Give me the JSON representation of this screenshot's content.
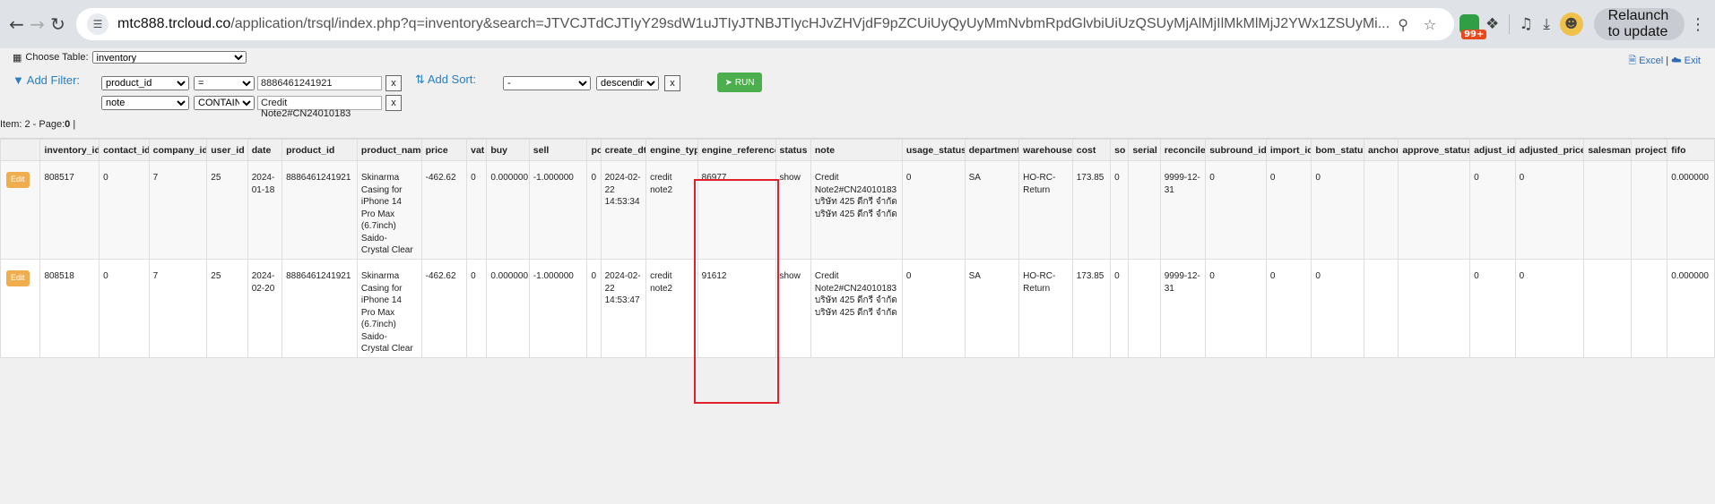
{
  "browser": {
    "url_host": "mtc888.trcloud.co",
    "url_rest": "/application/trsql/index.php?q=inventory&search=JTVCJTdCJTIyY29sdW1uJTIyJTNBJTIycHJvZHVjdF9pZCUiUyQyUyMmNvbmRpdGlvbiUiUzQSUyMjAlMjIlMkMlMjJ2YWx1ZSUyMi...",
    "extension_badge": "99+",
    "relaunch_label": "Relaunch to update"
  },
  "toolbar": {
    "choose_table_label": "Choose Table:",
    "table_value": "inventory",
    "excel_label": "Excel",
    "separator": "|",
    "exit_label": "Exit"
  },
  "filters": {
    "add_filter_label": "Add Filter:",
    "rows": [
      {
        "column": "product_id",
        "operator": "=",
        "value": "8886461241921",
        "remove": "x"
      },
      {
        "column": "note",
        "operator": "CONTAIN",
        "value": "Credit Note2#CN24010183",
        "remove": "x"
      }
    ]
  },
  "sort": {
    "add_sort_label": "Add Sort:",
    "column": "-",
    "direction": "descending",
    "remove": "x"
  },
  "run_label": "RUN",
  "item_info": "Item: 2 - Page:",
  "item_page": "0",
  "item_sep": "|",
  "table": {
    "columns": [
      "",
      "inventory_id",
      "contact_id",
      "company_id",
      "user_id",
      "date",
      "product_id",
      "product_name",
      "price",
      "vat",
      "buy",
      "sell",
      "po",
      "create_dt",
      "engine_type",
      "engine_reference",
      "status",
      "note",
      "usage_status",
      "department",
      "warehouse",
      "cost",
      "so",
      "serial",
      "reconcile",
      "subround_id",
      "import_id",
      "bom_status",
      "anchor",
      "approve_status",
      "adjust_id",
      "adjusted_price",
      "salesman",
      "project",
      "fifo"
    ],
    "edit_label": "Edit",
    "rows": [
      {
        "inventory_id": "808517",
        "contact_id": "0",
        "company_id": "7",
        "user_id": "25",
        "date": "2024-01-18",
        "product_id": "8886461241921",
        "product_name": "Skinarma Casing for iPhone 14 Pro Max (6.7inch) Saido- Crystal Clear",
        "price": "-462.62",
        "vat": "0",
        "buy": "0.000000",
        "sell": "-1.000000",
        "po": "0",
        "create_dt": "2024-02-22 14:53:34",
        "engine_type": "credit note2",
        "engine_reference": "86977",
        "status": "show",
        "note": "Credit Note2#CN24010183 บริษัท 425 ดีกรี จำกัด บริษัท 425 ดีกรี จำกัด",
        "usage_status": "0",
        "department": "SA",
        "warehouse": "HO-RC-Return",
        "cost": "173.85",
        "so": "0",
        "serial": "",
        "reconcile": "9999-12-31",
        "subround_id": "0",
        "import_id": "0",
        "bom_status": "0",
        "anchor": "",
        "approve_status": "",
        "adjust_id": "0",
        "adjusted_price": "0",
        "salesman": "",
        "project": "",
        "fifo": "0.000000"
      },
      {
        "inventory_id": "808518",
        "contact_id": "0",
        "company_id": "7",
        "user_id": "25",
        "date": "2024-02-20",
        "product_id": "8886461241921",
        "product_name": "Skinarma Casing for iPhone 14 Pro Max (6.7inch) Saido- Crystal Clear",
        "price": "-462.62",
        "vat": "0",
        "buy": "0.000000",
        "sell": "-1.000000",
        "po": "0",
        "create_dt": "2024-02-22 14:53:47",
        "engine_type": "credit note2",
        "engine_reference": "91612",
        "status": "show",
        "note": "Credit Note2#CN24010183 บริษัท 425 ดีกรี จำกัด บริษัท 425 ดีกรี จำกัด",
        "usage_status": "0",
        "department": "SA",
        "warehouse": "HO-RC-Return",
        "cost": "173.85",
        "so": "0",
        "serial": "",
        "reconcile": "9999-12-31",
        "subround_id": "0",
        "import_id": "0",
        "bom_status": "0",
        "anchor": "",
        "approve_status": "",
        "adjust_id": "0",
        "adjusted_price": "0",
        "salesman": "",
        "project": "",
        "fifo": "0.000000"
      }
    ]
  }
}
